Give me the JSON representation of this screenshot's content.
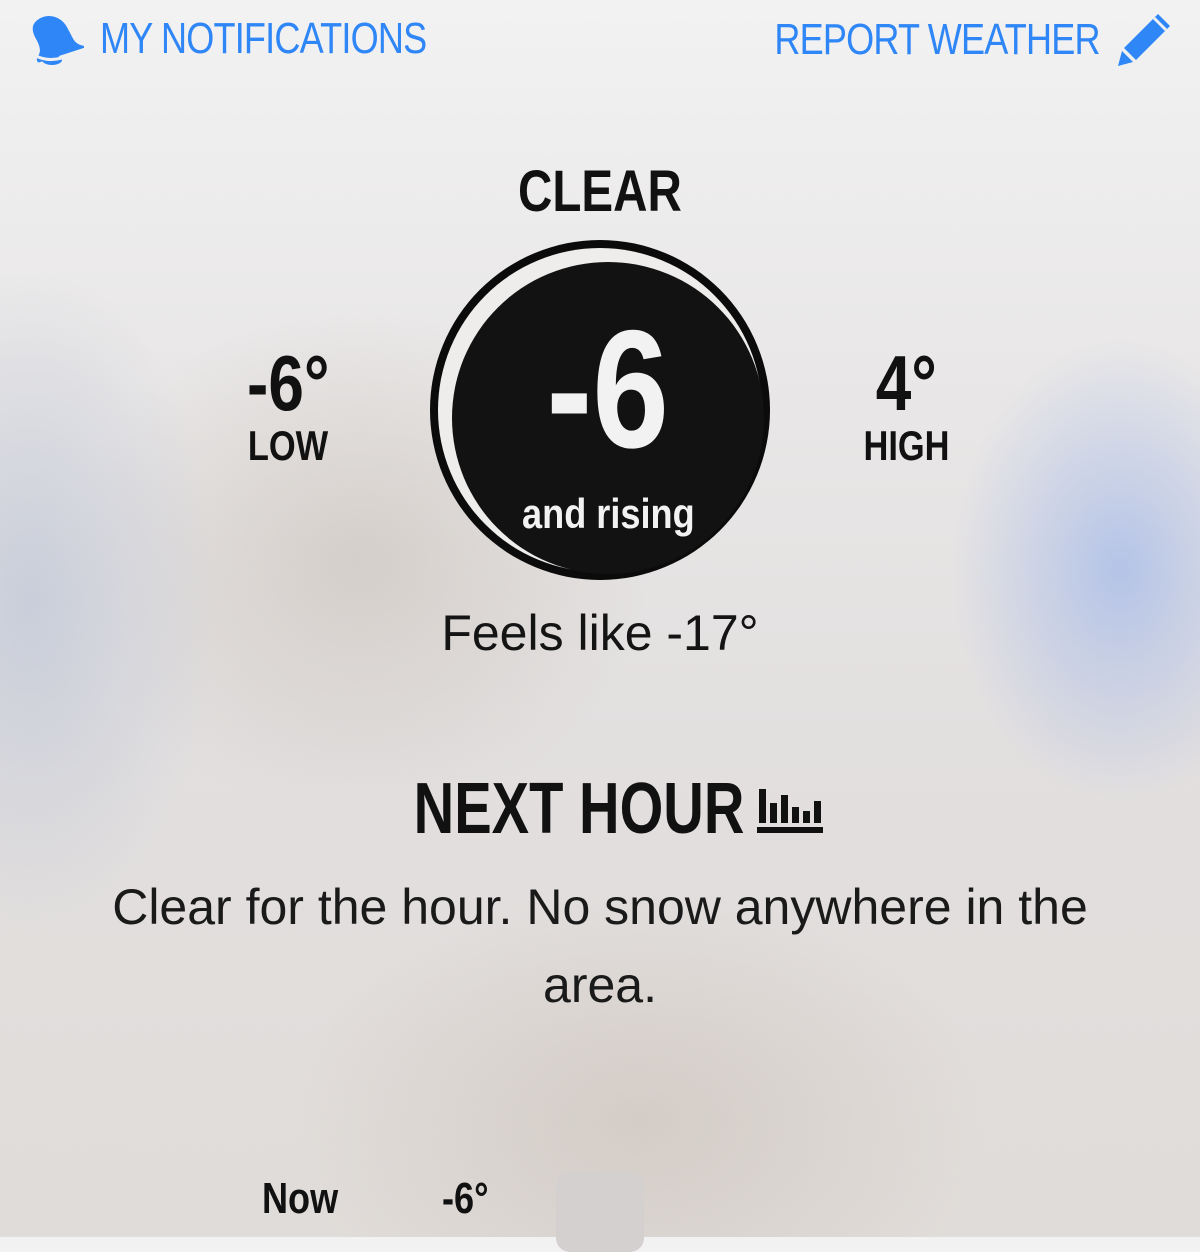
{
  "header": {
    "notifications_label": "MY NOTIFICATIONS",
    "notifications_icon": "bell-icon",
    "report_label": "REPORT WEATHER",
    "report_icon": "pencil-icon",
    "link_color": "#2f86f6"
  },
  "current": {
    "condition": "CLEAR",
    "temperature": "-6",
    "trend": "and rising",
    "feels_like": "Feels like -17°",
    "low": {
      "value": "-6°",
      "label": "LOW"
    },
    "high": {
      "value": "4°",
      "label": "HIGH"
    }
  },
  "next_hour": {
    "title": "NEXT HOUR",
    "icon": "bar-chart-icon",
    "summary": "Clear for the hour. No snow anywhere in the area."
  },
  "hourly": [
    {
      "time": "Now",
      "temp": "-6°"
    }
  ]
}
